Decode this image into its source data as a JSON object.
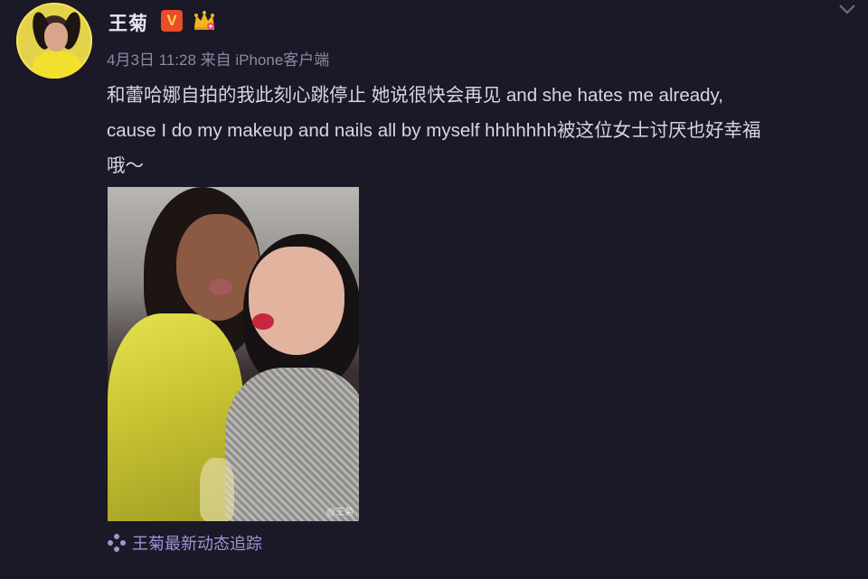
{
  "user": {
    "name": "王菊",
    "verified_badge": "V",
    "crown_badge_icon": "crown-icon"
  },
  "post": {
    "meta": "4月3日 11:28 来自 iPhone客户端",
    "text": "和蕾哈娜自拍的我此刻心跳停止 她说很快会再见 and she hates me already,\ncause I do my makeup and nails all by myself hhhhhhh被这位女士讨厌也好幸福\n哦～",
    "photo_watermark": "@王菊"
  },
  "footer": {
    "label": "王菊最新动态追踪",
    "icon": "sparkle-icon"
  },
  "colors": {
    "background": "#1b1828",
    "text": "#d7d5e3",
    "meta": "#8c89a3",
    "link": "#9c97d0",
    "verified": "#e94b2b"
  }
}
